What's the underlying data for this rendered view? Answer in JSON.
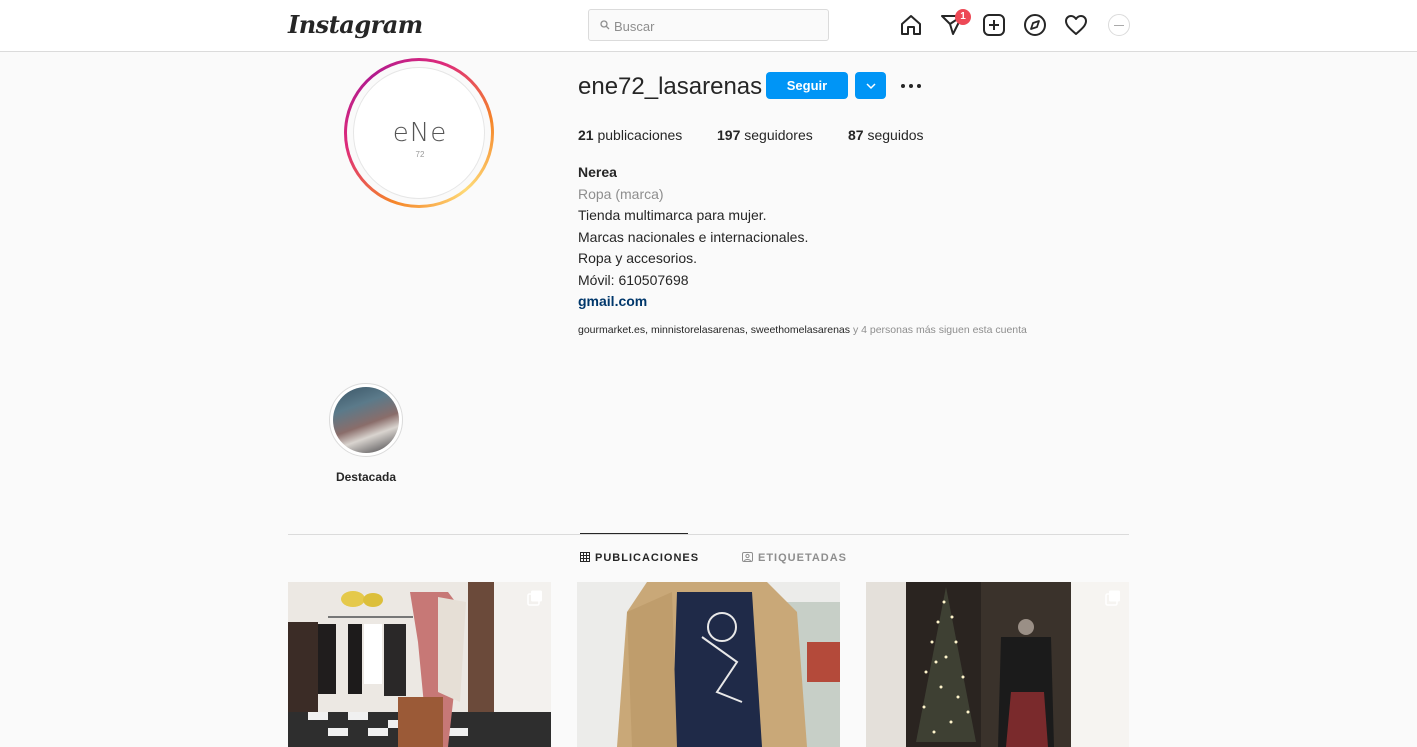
{
  "nav": {
    "logo": "Instagram",
    "search_placeholder": "Buscar",
    "activity_badge": "1",
    "icons": [
      "home-icon",
      "direct-icon",
      "new-post-icon",
      "explore-icon",
      "activity-heart-icon",
      "avatar"
    ]
  },
  "profile": {
    "username": "ene72_lasarenas",
    "follow_label": "Seguir",
    "picture_logo": "eNe",
    "picture_sub": "72",
    "stats": [
      {
        "count": "21",
        "label": "publicaciones"
      },
      {
        "count": "197",
        "label": "seguidores"
      },
      {
        "count": "87",
        "label": "seguidos"
      }
    ],
    "bio": {
      "name": "Nerea",
      "category": "Ropa (marca)",
      "lines": [
        "Tienda multimarca para mujer.",
        "Marcas nacionales e internacionales.",
        "Ropa y accesorios.",
        "Móvil: 610507698"
      ],
      "link": "gmail.com"
    },
    "followed_by": {
      "accounts": [
        "gourmarket.es",
        "minnistorelasarenas",
        "sweethomelasarenas"
      ],
      "suffix": "y 4 personas más siguen esta cuenta"
    }
  },
  "highlights": [
    {
      "label": "Destacada"
    }
  ],
  "tabs": [
    {
      "label": "PUBLICACIONES",
      "active": true
    },
    {
      "label": "ETIQUETADAS",
      "active": false
    }
  ],
  "colors": {
    "accent": "#0095f6",
    "badge": "#ed4956",
    "link": "#00376b",
    "muted": "#8e8e8e",
    "border": "#dbdbdb"
  }
}
